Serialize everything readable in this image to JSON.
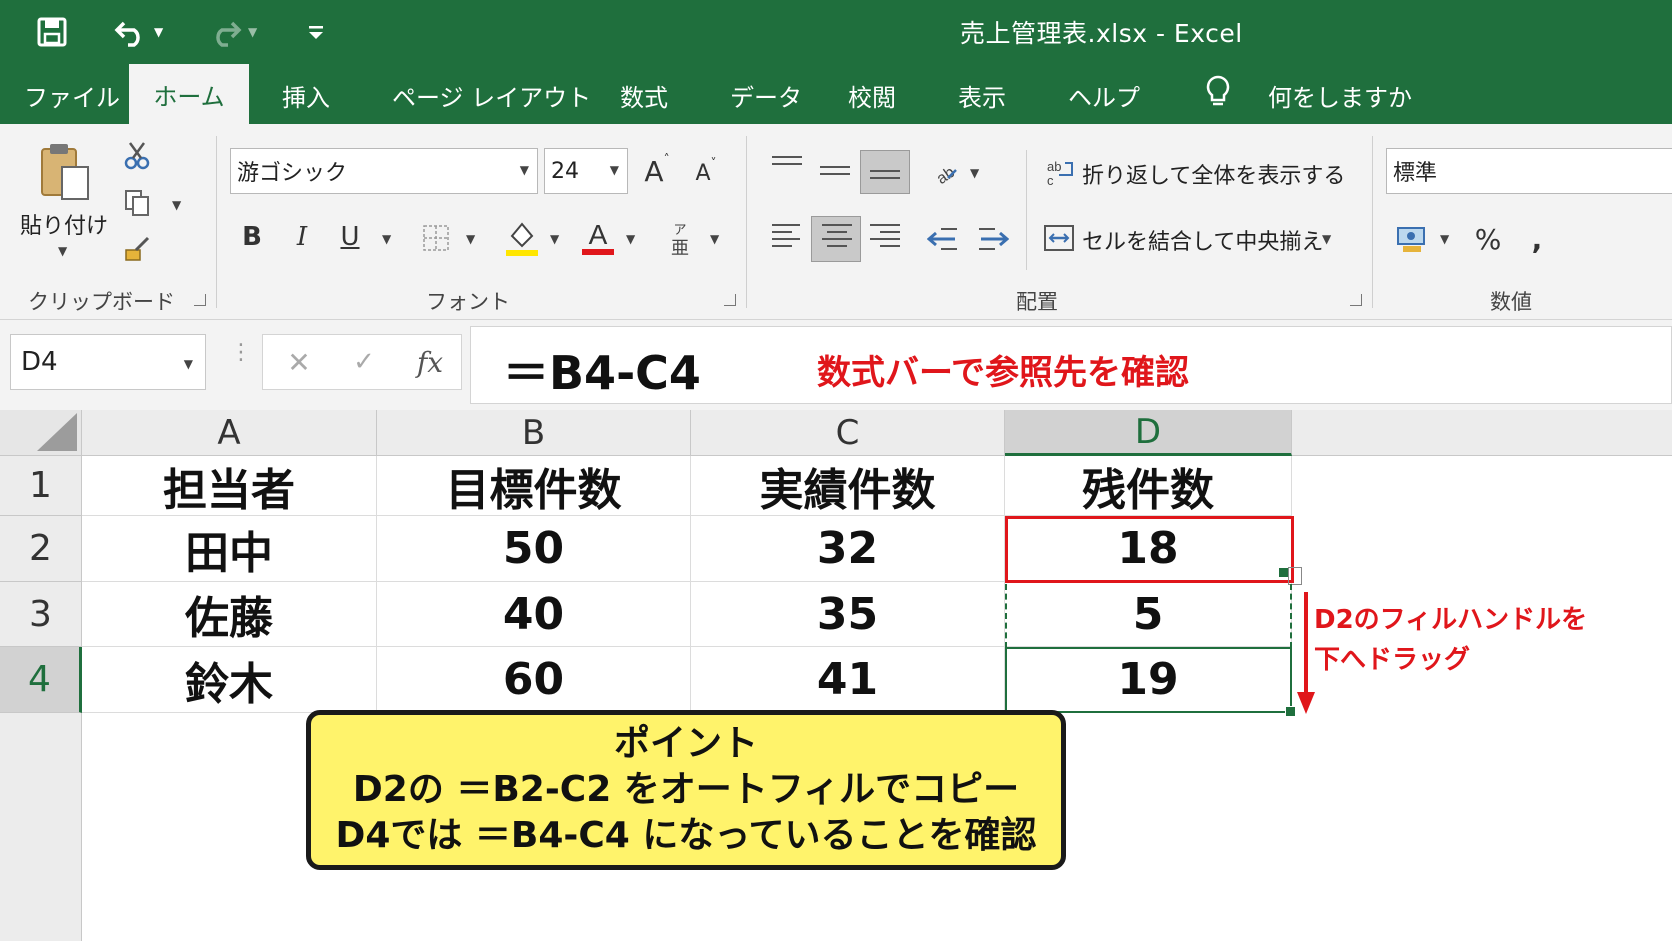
{
  "titlebar": {
    "title": "売上管理表.xlsx  -  Excel",
    "icons": [
      "save-icon",
      "undo-icon",
      "redo-icon",
      "customize-icon"
    ]
  },
  "tabs": {
    "file": "ファイル",
    "home": "ホーム",
    "insert": "挿入",
    "page_layout": "ページ レイアウト",
    "formulas": "数式",
    "data": "データ",
    "review": "校閲",
    "view": "表示",
    "help": "ヘルプ",
    "tell_me": "何をしますか"
  },
  "ribbon": {
    "clipboard": {
      "paste": "貼り付け",
      "label": "クリップボード"
    },
    "font": {
      "family": "游ゴシック",
      "size": "24",
      "label": "フォント"
    },
    "alignment": {
      "wrap_text": "折り返して全体を表示する",
      "merge_center": "セルを結合して中央揃え",
      "label": "配置"
    },
    "number": {
      "format": "標準",
      "label": "数値"
    }
  },
  "formula_bar": {
    "name_box": "D4",
    "formula": "＝B4-C4",
    "annotation": "数式バーで参照先を確認"
  },
  "sheet": {
    "columns": [
      "A",
      "B",
      "C",
      "D"
    ],
    "rows": [
      "1",
      "2",
      "3",
      "4"
    ],
    "cells": [
      [
        "担当者",
        "目標件数",
        "実績件数",
        "残件数"
      ],
      [
        "田中",
        "50",
        "32",
        "18"
      ],
      [
        "佐藤",
        "40",
        "35",
        "5"
      ],
      [
        "鈴木",
        "60",
        "41",
        "19"
      ]
    ],
    "selected_cell": "D4"
  },
  "annotations": {
    "drag_note_line1": "D2のフィルハンドルを",
    "drag_note_line2": "下へドラッグ",
    "callout_line1": "ポイント",
    "callout_line2": "D2の ＝B2-C2 をオートフィルでコピー",
    "callout_line3": "D4では ＝B4-C4 になっていることを確認"
  },
  "colors": {
    "excel_green": "#1f6f3d",
    "annotation_red": "#e0161b",
    "callout_yellow": "#fff36b"
  }
}
